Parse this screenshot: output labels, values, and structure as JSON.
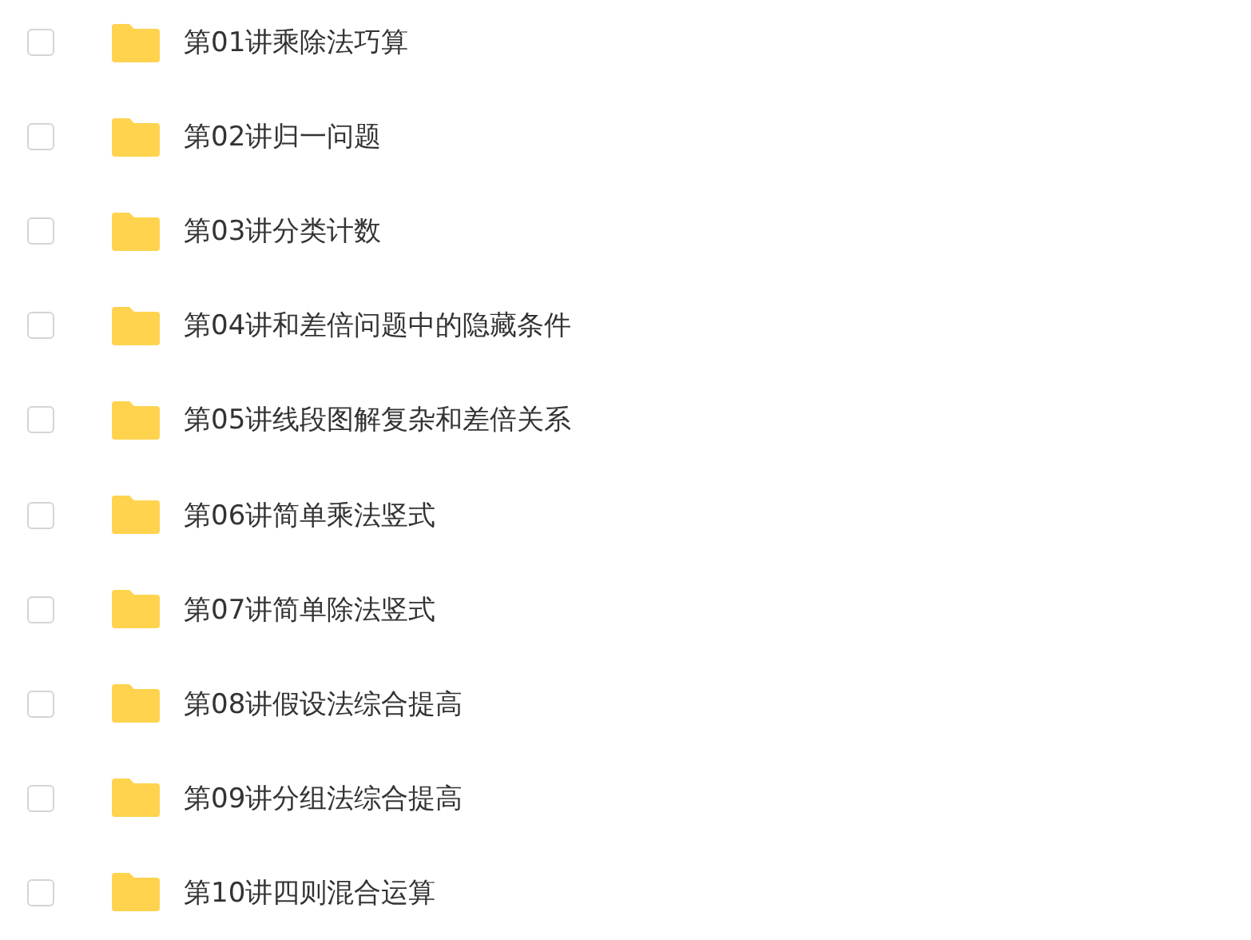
{
  "files": [
    {
      "name": "第01讲乘除法巧算",
      "checked": false
    },
    {
      "name": "第02讲归一问题",
      "checked": false
    },
    {
      "name": "第03讲分类计数",
      "checked": false
    },
    {
      "name": "第04讲和差倍问题中的隐藏条件",
      "checked": false
    },
    {
      "name": "第05讲线段图解复杂和差倍关系",
      "checked": false
    },
    {
      "name": "第06讲简单乘法竖式",
      "checked": false
    },
    {
      "name": "第07讲简单除法竖式",
      "checked": false
    },
    {
      "name": "第08讲假设法综合提高",
      "checked": false
    },
    {
      "name": "第09讲分组法综合提高",
      "checked": false
    },
    {
      "name": "第10讲四则混合运算",
      "checked": false
    }
  ]
}
